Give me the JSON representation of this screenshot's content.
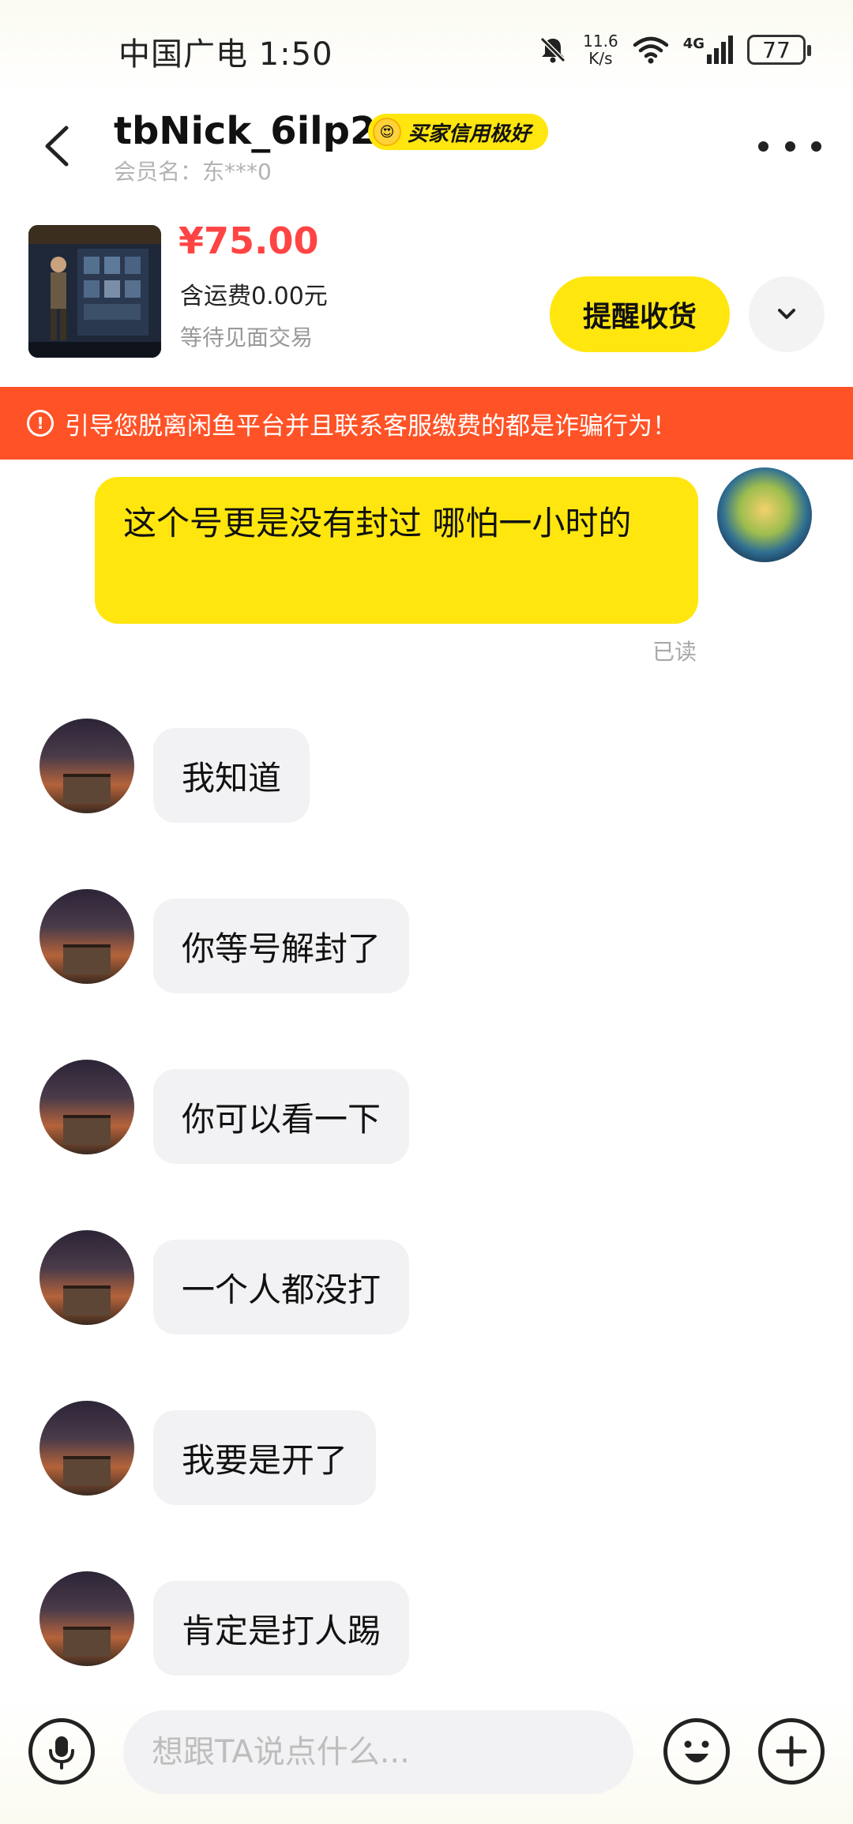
{
  "status_bar": {
    "carrier_time": "中国广电 1:50",
    "net_speed_value": "11.6",
    "net_speed_unit": "K/s",
    "network": "4G",
    "battery": "77",
    "icons": [
      "mute-bell-icon",
      "wifi-icon",
      "signal-icon",
      "battery-icon"
    ]
  },
  "header": {
    "nickname": "tbNick_6ilp2",
    "credit_badge": "买家信用极好",
    "member_name": "会员名：东***0"
  },
  "product": {
    "price": "¥75.00",
    "shipping": "含运费0.00元",
    "trade_status": "等待见面交易",
    "remind_button": "提醒收货"
  },
  "warning": {
    "text": "引导您脱离闲鱼平台并且联系客服缴费的都是诈骗行为！",
    "color": "#ff5226"
  },
  "chat": {
    "my_message": {
      "text": "这个号更是没有封过 哪怕一小时的",
      "status": "已读"
    },
    "peer_messages": [
      {
        "text": "我知道"
      },
      {
        "text": "你等号解封了"
      },
      {
        "text": "你可以看一下"
      },
      {
        "text": "一个人都没打"
      },
      {
        "text": "我要是开了"
      },
      {
        "text": "肯定是打人踢"
      }
    ]
  },
  "input_bar": {
    "placeholder": "想跟TA说点什么..."
  },
  "colors": {
    "accent_yellow": "#ffe60f",
    "price_red": "#ff4444",
    "bubble_gray": "#f2f2f4"
  }
}
